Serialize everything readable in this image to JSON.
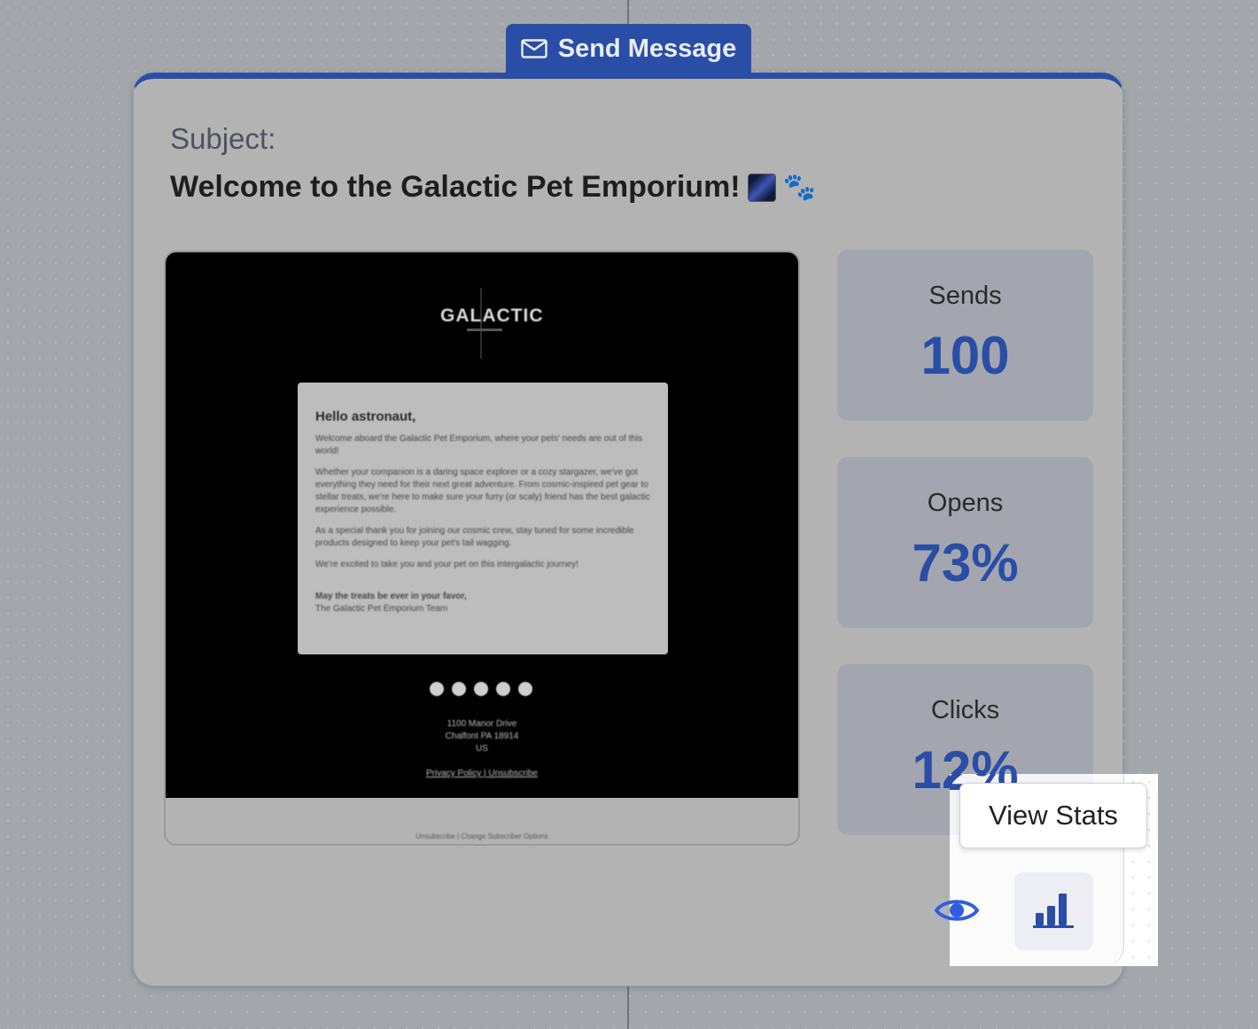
{
  "node": {
    "tab_label": "Send Message",
    "tab_icon": "envelope-icon",
    "accent_color": "#2a4da6"
  },
  "subject": {
    "label": "Subject:",
    "text": "Welcome to the Galactic Pet Emporium!",
    "emoji_icons": [
      "milky-way-icon",
      "paw-prints-icon"
    ]
  },
  "email_preview": {
    "logo_text": "GALACTIC",
    "greeting": "Hello astronaut,",
    "paragraphs": [
      "Welcome aboard the Galactic Pet Emporium, where your pets' needs are out of this world!",
      "Whether your companion is a daring space explorer or a cozy stargazer, we've got everything they need for their next great adventure. From cosmic-inspired pet gear to stellar treats, we're here to make sure your furry (or scaly) friend has the best galactic experience possible.",
      "As a special thank you for joining our cosmic crew, stay tuned for some incredible products designed to keep your pet's tail wagging.",
      "We're excited to take you and your pet on this intergalactic journey!"
    ],
    "signoff_bold": "May the treats be ever in your favor,",
    "signoff_team": "The Galactic Pet Emporium Team",
    "social_icons": [
      "facebook-icon",
      "x-icon",
      "instagram-icon",
      "youtube-icon",
      "linkedin-icon"
    ],
    "address_lines": [
      "1100 Manor Drive",
      "Chalfont PA 18914",
      "US"
    ],
    "links": "Privacy Policy | Unsubscribe",
    "footer_links": "Unsubscribe  |  Change Subscriber Options"
  },
  "stats": [
    {
      "label": "Sends",
      "value": "100"
    },
    {
      "label": "Opens",
      "value": "73%"
    },
    {
      "label": "Clicks",
      "value": "12%"
    }
  ],
  "actions": {
    "preview_icon": "eye-icon",
    "stats_icon": "bar-chart-icon",
    "tooltip": "View Stats"
  }
}
